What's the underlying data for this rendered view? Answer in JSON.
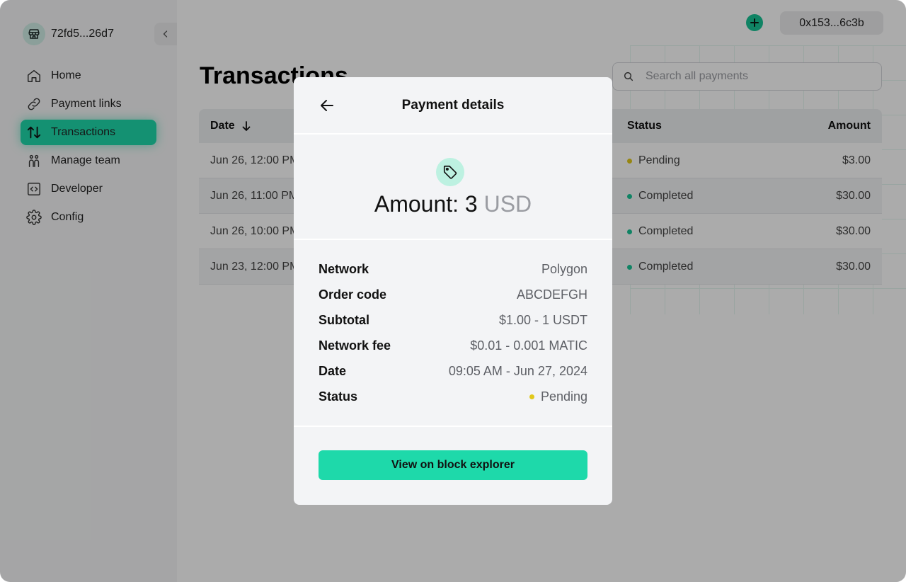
{
  "sidebar": {
    "store_name": "72fd5...26d7",
    "items": [
      {
        "label": "Home",
        "icon": "home-icon"
      },
      {
        "label": "Payment links",
        "icon": "link-icon"
      },
      {
        "label": "Transactions",
        "icon": "swap-icon",
        "active": true
      },
      {
        "label": "Manage team",
        "icon": "team-icon"
      },
      {
        "label": "Developer",
        "icon": "code-icon"
      },
      {
        "label": "Config",
        "icon": "gear-icon"
      }
    ]
  },
  "header": {
    "wallet": "0x153...6c3b"
  },
  "page": {
    "title": "Transactions",
    "search_placeholder": "Search all payments"
  },
  "table": {
    "columns": {
      "date": "Date",
      "status": "Status",
      "amount": "Amount"
    },
    "rows": [
      {
        "date": "Jun 26, 12:00 PM",
        "status": "Pending",
        "amount": "$3.00"
      },
      {
        "date": "Jun 26, 11:00 PM",
        "status": "Completed",
        "amount": "$30.00"
      },
      {
        "date": "Jun 26, 10:00 PM",
        "status": "Completed",
        "amount": "$30.00"
      },
      {
        "date": "Jun 23, 12:00 PM",
        "status": "Completed",
        "amount": "$30.00"
      }
    ]
  },
  "modal": {
    "title": "Payment details",
    "amount_prefix": "Amount: 3",
    "currency": "USD",
    "details": [
      {
        "key": "Network",
        "value": "Polygon"
      },
      {
        "key": "Order code",
        "value": "ABCDEFGH"
      },
      {
        "key": "Subtotal",
        "value": "$1.00 - 1 USDT"
      },
      {
        "key": "Network fee",
        "value": "$0.01 - 0.001 MATIC"
      },
      {
        "key": "Date",
        "value": "09:05 AM - Jun 27, 2024"
      },
      {
        "key": "Status",
        "value": "Pending"
      }
    ],
    "button": "View on block explorer"
  },
  "colors": {
    "accent": "#1ed9aa",
    "pending": "#e1c81a",
    "completed": "#18c396"
  }
}
